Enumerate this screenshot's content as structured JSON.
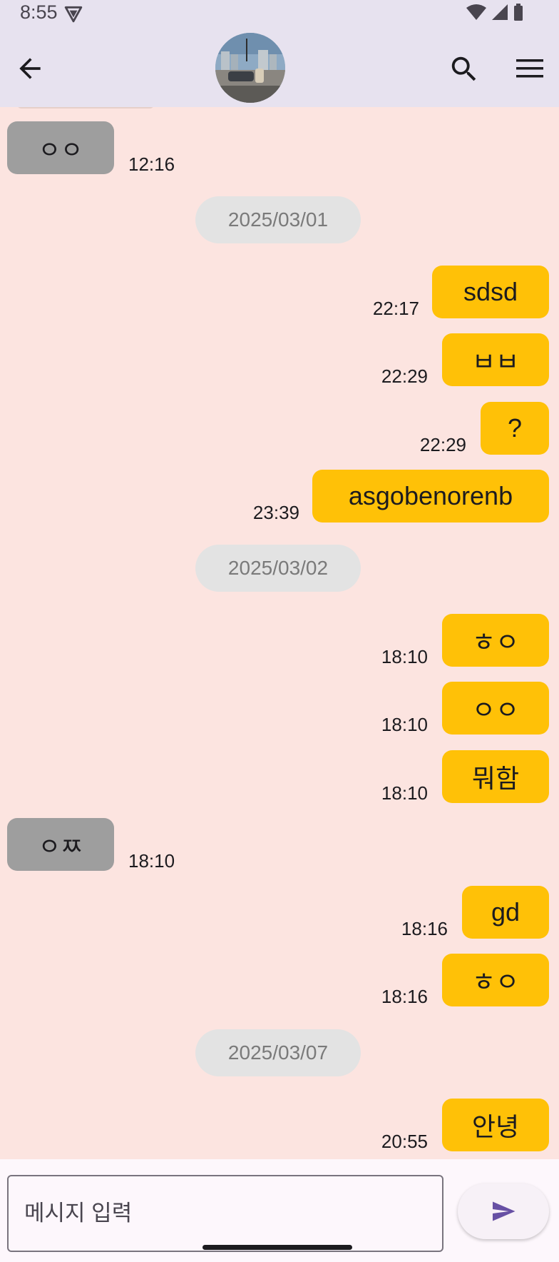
{
  "status_bar": {
    "time": "8:55",
    "icons": [
      "vpn-icon",
      "wifi-icon",
      "cell-signal-icon",
      "battery-icon"
    ]
  },
  "app_bar": {
    "back_icon": "arrow-back-icon",
    "search_icon": "search-icon",
    "menu_icon": "menu-icon",
    "avatar": "profile-photo"
  },
  "messages": [
    {
      "type": "in",
      "text": "ㅇㅇ",
      "time": "12:16"
    },
    {
      "type": "date",
      "text": "2025/03/01"
    },
    {
      "type": "out",
      "text": "sdsd",
      "time": "22:17"
    },
    {
      "type": "out",
      "text": "ㅂㅂ",
      "time": "22:29"
    },
    {
      "type": "out",
      "text": "?",
      "time": "22:29"
    },
    {
      "type": "out",
      "text": "asgobenorenb",
      "time": "23:39"
    },
    {
      "type": "date",
      "text": "2025/03/02"
    },
    {
      "type": "out",
      "text": "ㅎㅇ",
      "time": "18:10"
    },
    {
      "type": "out",
      "text": "ㅇㅇ",
      "time": "18:10"
    },
    {
      "type": "out",
      "text": "뭐함",
      "time": "18:10"
    },
    {
      "type": "in",
      "text": "ㅇㅉ",
      "time": "18:10"
    },
    {
      "type": "out",
      "text": "gd",
      "time": "18:16"
    },
    {
      "type": "out",
      "text": "ㅎㅇ",
      "time": "18:16"
    },
    {
      "type": "date",
      "text": "2025/03/07"
    },
    {
      "type": "out",
      "text": "안녕",
      "time": "20:55"
    }
  ],
  "composer": {
    "placeholder": "메시지 입력",
    "send_icon": "send-icon"
  },
  "colors": {
    "incoming_bubble": "#9e9e9e",
    "outgoing_bubble": "#ffc107",
    "chat_background": "#fce4e0",
    "app_bar": "#e7e2ef",
    "send_accent": "#6750a4"
  }
}
